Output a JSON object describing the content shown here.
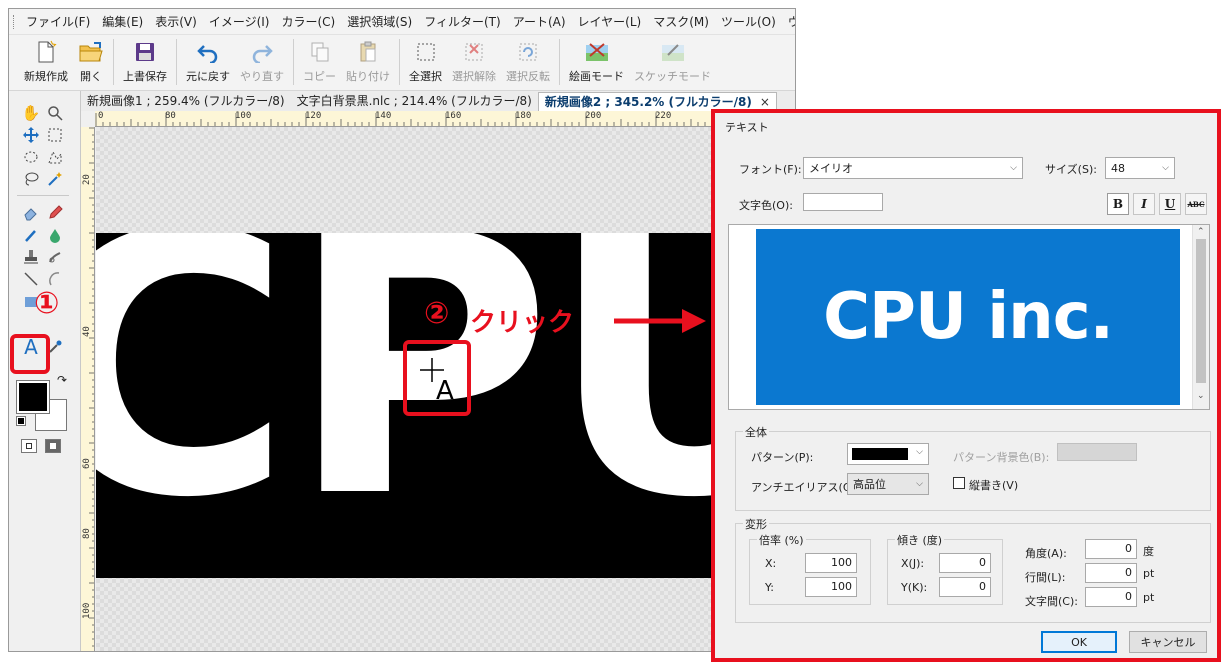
{
  "menu": [
    "ファイル(F)",
    "編集(E)",
    "表示(V)",
    "イメージ(I)",
    "カラー(C)",
    "選択領域(S)",
    "フィルター(T)",
    "アート(A)",
    "レイヤー(L)",
    "マスク(M)",
    "ツール(O)",
    "ウィンドウ(W"
  ],
  "toolbar": {
    "new": "新規作成",
    "open": "開く",
    "save": "上書保存",
    "undo": "元に戻す",
    "redo": "やり直す",
    "copy": "コピー",
    "paste": "貼り付け",
    "select_all": "全選択",
    "deselect": "選択解除",
    "invert": "選択反転",
    "paint_mode": "絵画モード",
    "sketch_mode": "スケッチモード"
  },
  "tabs": [
    "新規画像1 ; 259.4% (フルカラー/8)",
    "文字白背景黒.nlc ; 214.4% (フルカラー/8)",
    "新規画像2 ; 345.2% (フルカラー/8)"
  ],
  "tab_close": "×",
  "ruler_top": [
    "0",
    "80",
    "100",
    "120",
    "140",
    "160",
    "180",
    "200",
    "220"
  ],
  "ruler_left": [
    "20",
    "40",
    "60",
    "80",
    "100"
  ],
  "canvas_text": "CPU",
  "annotations": {
    "step1": "①",
    "step2": "②",
    "click_label": "クリック",
    "arrow": "→"
  },
  "cursor_letter": "A",
  "dialog": {
    "title": "テキスト",
    "font_label": "フォント(F):",
    "font_value": "メイリオ",
    "size_label": "サイズ(S):",
    "size_value": "48",
    "color_label": "文字色(O):",
    "style_buttons": [
      "B",
      "I",
      "U",
      "ABC"
    ],
    "preview_text": "CPU inc.",
    "preview_bg": "#0b78d0",
    "group_all": "全体",
    "pattern_label": "パターン(P):",
    "pattern_bg_label": "パターン背景色(B):",
    "antialias_label": "アンチエイリアス(Q):",
    "antialias_value": "高品位",
    "vertical_label": "縦書き(V)",
    "group_transform": "変形",
    "scale_title": "倍率 (%)",
    "scale_x_label": "X:",
    "scale_x": "100",
    "scale_y_label": "Y:",
    "scale_y": "100",
    "skew_title": "傾き (度)",
    "skew_x_label": "X(J):",
    "skew_x": "0",
    "skew_y_label": "Y(K):",
    "skew_y": "0",
    "angle_label": "角度(A):",
    "angle": "0",
    "angle_unit": "度",
    "line_label": "行間(L):",
    "line": "0",
    "line_unit": "pt",
    "char_label": "文字間(C):",
    "char": "0",
    "char_unit": "pt",
    "ok": "OK",
    "cancel": "キャンセル"
  },
  "colors": {
    "accent_red": "#e8101e",
    "blue": "#0b78d0"
  }
}
